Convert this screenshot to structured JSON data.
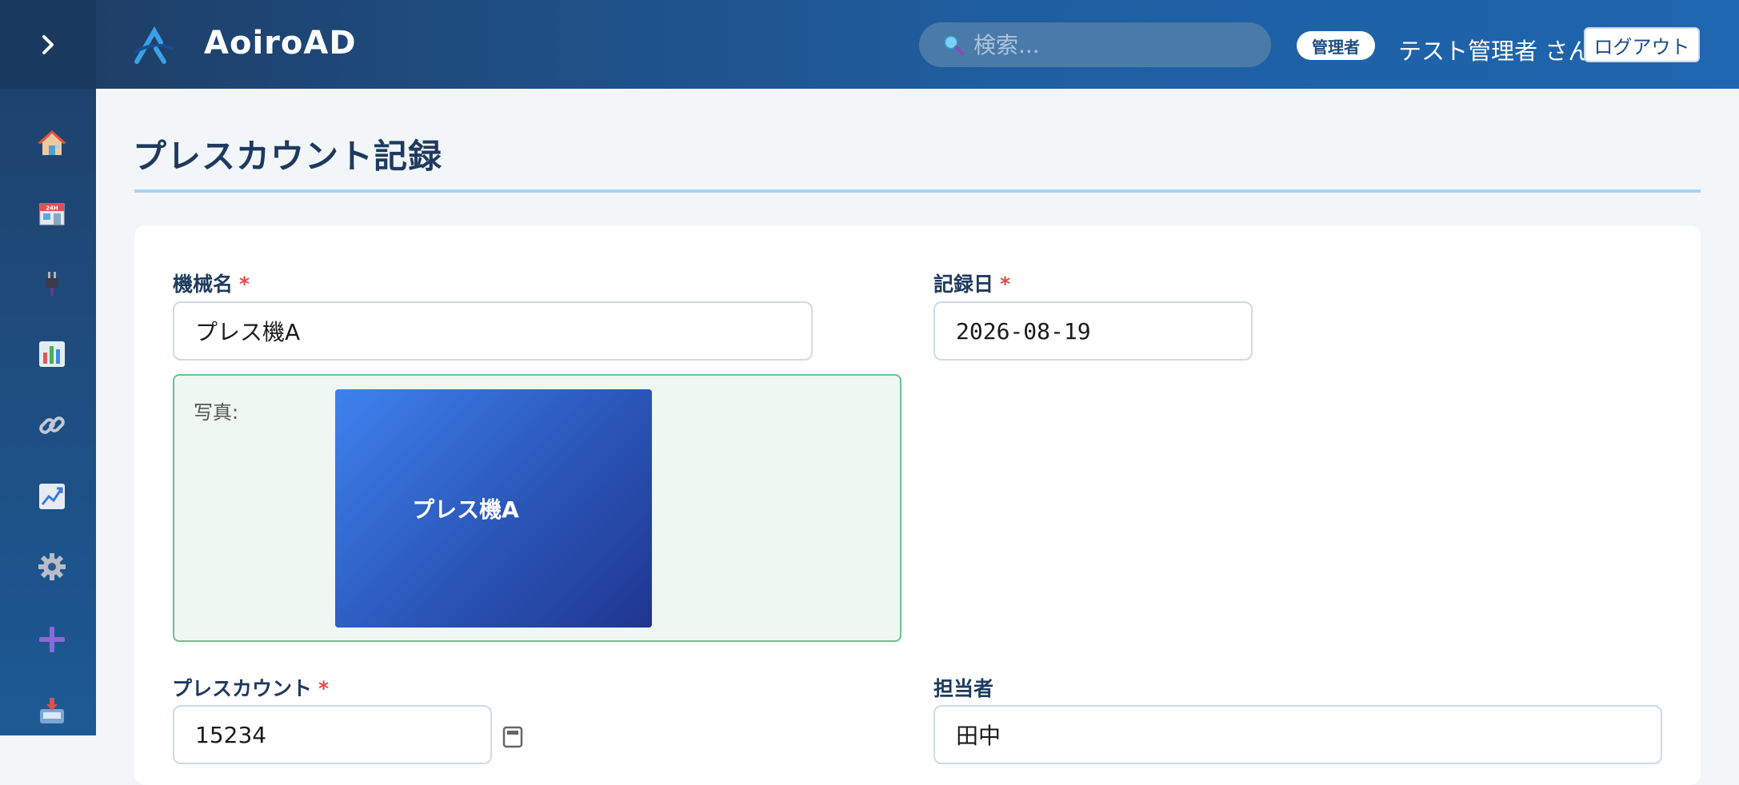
{
  "header": {
    "brand": "AoiroAD",
    "search_placeholder": "検索...",
    "role_badge": "管理者",
    "user_name": "テスト管理者 さん",
    "logout_label": "ログアウト"
  },
  "sidebar": {
    "items": [
      {
        "icon": "home-icon"
      },
      {
        "icon": "store-icon"
      },
      {
        "icon": "plug-icon"
      },
      {
        "icon": "bar-chart-icon"
      },
      {
        "icon": "link-icon"
      },
      {
        "icon": "trend-chart-icon"
      },
      {
        "icon": "gear-icon"
      },
      {
        "icon": "plus-icon"
      },
      {
        "icon": "inbox-tray-icon"
      }
    ]
  },
  "page": {
    "title": "プレスカウント記録"
  },
  "form": {
    "machine_label": "機械名",
    "machine_value": "プレス機A",
    "date_label": "記録日",
    "date_value": "2026-08-19",
    "required_mark": "*",
    "photo_label": "写真:",
    "photo_caption": "プレス機A",
    "count_label": "プレスカウント",
    "count_value": "15234",
    "person_label": "担当者",
    "person_value": "田中"
  },
  "colors": {
    "accent": "#1e66b0",
    "sidebar": "#1e3f68",
    "required": "#e24b4b",
    "photo_border": "#6bc38a"
  }
}
